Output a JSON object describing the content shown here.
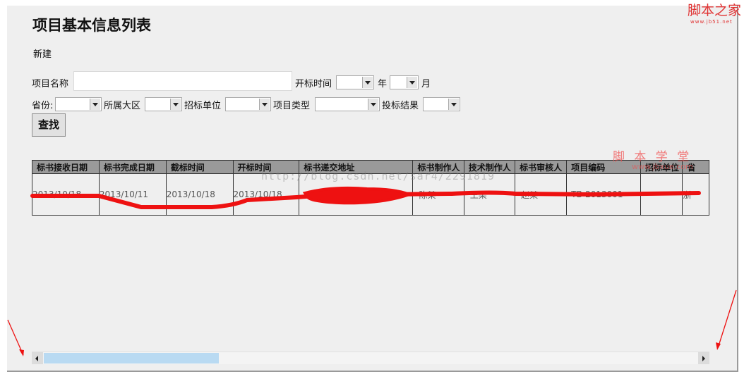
{
  "page": {
    "title": "项目基本信息列表",
    "new_link": "新建"
  },
  "form": {
    "project_name_label": "项目名称",
    "open_time_label": "开标时间",
    "year_label": "年",
    "month_label": "月",
    "province_label": "省份:",
    "region_label": "所属大区",
    "bidder_label": "招标单位",
    "project_type_label": "项目类型",
    "bid_result_label": "投标结果",
    "find_button": "查找"
  },
  "table": {
    "headers": [
      "标书接收日期",
      "标书完成日期",
      "截标时间",
      "开标时间",
      "标书递交地址",
      "标书制作人",
      "技术制作人",
      "标书审核人",
      "项目编码",
      "招标单位",
      "省"
    ],
    "row": [
      "2013/10/18",
      "2013/10/11",
      "2013/10/18",
      "2013/10/18",
      "",
      "陈某",
      "王某",
      "赵某",
      "TB-2013001",
      "",
      "浙"
    ]
  },
  "watermarks": {
    "blog_url": "http://blog.csdn.net/sar4/2291819",
    "stamp_title": "脚 本 学 堂",
    "stamp_url": "www.jbxue.com",
    "logo_title": "脚本之家",
    "logo_url": "www.jb51.net"
  },
  "colors": {
    "annotation_red": "#ee1111",
    "header_gray": "#9a9a9a",
    "scroll_thumb": "#b9daf2"
  }
}
